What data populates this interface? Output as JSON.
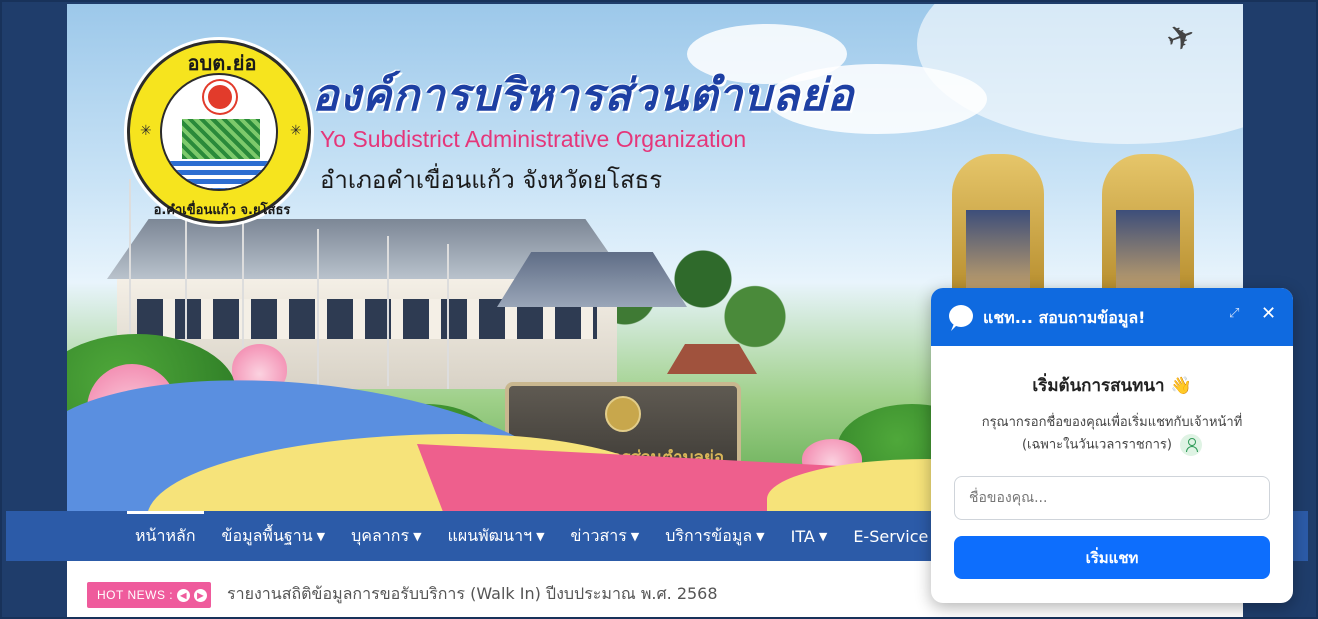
{
  "header": {
    "logo_top_text": "อบต.ย่อ",
    "logo_bottom_text": "อ.คำเขื่อนแก้ว จ.ยโสธร",
    "org_name_thai": "องค์การบริหารส่วนตำบลย่อ",
    "org_name_en": "Yo Subdistrict Administrative Organization",
    "district": "อำเภอคำเขื่อนแก้ว จังหวัดยโสธร",
    "sign_text": "องค์การบริหารส่วนตำบลย่อ"
  },
  "nav": {
    "items": [
      {
        "label": "หน้าหลัก",
        "caret": ""
      },
      {
        "label": "ข้อมูลพื้นฐาน",
        "caret": "▼"
      },
      {
        "label": "บุคลากร",
        "caret": "▼"
      },
      {
        "label": "แผนพัฒนาฯ",
        "caret": "▼"
      },
      {
        "label": "ข่าวสาร",
        "caret": "▼"
      },
      {
        "label": "บริการข้อมูล",
        "caret": "▼"
      },
      {
        "label": "ITA",
        "caret": "▼"
      },
      {
        "label": "E-Service",
        "caret": ""
      }
    ]
  },
  "news": {
    "badge": "HOT NEWS :",
    "headline": "รายงานสถิติข้อมูลการขอรับบริการ (Walk In) ปีงบประมาณ พ.ศ. 2568"
  },
  "chat": {
    "title": "แชท... สอบถามข้อมูล!",
    "heading": "เริ่มต้นการสนทนา 👋",
    "desc_line1": "กรุณากรอกชื่อของคุณเพื่อเริ่มแชทกับเจ้าหน้าที่",
    "desc_line2": "(เฉพาะในวันเวลาราชการ)",
    "name_value": "",
    "name_placeholder": "ชื่อของคุณ...",
    "start_button": "เริ่มแชท",
    "expand_symbol": "⤢",
    "close_symbol": "✕"
  },
  "colors": {
    "nav_bg": "#2c5ba8",
    "chat_header": "#0f6ae0",
    "chat_button": "#0d6efd",
    "hot_news_badge": "#ef5b9c",
    "org_name_thai": "#1d3fa3",
    "org_name_en": "#e5367a"
  }
}
